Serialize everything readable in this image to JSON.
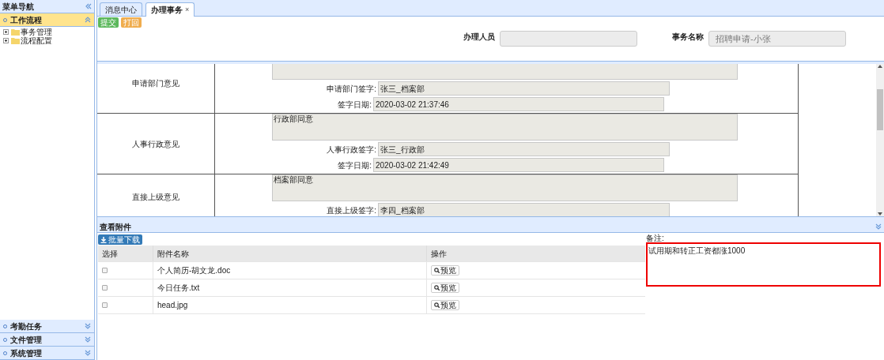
{
  "sidebar": {
    "title": "菜单导航",
    "sections": [
      {
        "title": "工作流程",
        "expanded": true,
        "children": [
          {
            "label": "事务管理"
          },
          {
            "label": "流程配置"
          }
        ]
      },
      {
        "title": "考勤任务",
        "expanded": false
      },
      {
        "title": "文件管理",
        "expanded": false
      },
      {
        "title": "系统管理",
        "expanded": false
      }
    ]
  },
  "tabs": [
    {
      "label": "消息中心",
      "selected": false
    },
    {
      "label": "办理事务",
      "selected": true,
      "close": "×"
    }
  ],
  "toolbar": [
    {
      "label": "提交",
      "kind": "submit"
    },
    {
      "label": "打回",
      "kind": "reject"
    }
  ],
  "header_fields": [
    {
      "label": "办理人员"
    },
    {
      "label": "事务名称",
      "value": "招聘申请-小张"
    }
  ],
  "opinions": [
    {
      "label": "申请部门意见",
      "sign_label": "申请部门签字:",
      "sign": "张三_档案部",
      "date_label": "签字日期:",
      "date": "2020-03-02 21:37:46"
    },
    {
      "label": "人事行政意见",
      "comment": "行政部同意",
      "sign_label": "人事行政签字:",
      "sign": "张三_行政部",
      "date_label": "签字日期:",
      "date": "2020-03-02 21:42:49"
    },
    {
      "label": "直接上级意见",
      "comment": "档案部同意",
      "sign_label": "直接上级签字:",
      "sign": "李四_档案部"
    }
  ],
  "attachments": {
    "title": "查看附件",
    "download_button": "批量下载",
    "columns": [
      "选择",
      "附件名称",
      "操作"
    ],
    "rows": [
      {
        "checked": false,
        "name": "个人简历-胡文龙.doc",
        "action": "预览"
      },
      {
        "checked": false,
        "name": "今日任务.txt",
        "action": "预览"
      },
      {
        "checked": false,
        "name": "head.jpg",
        "action": "预览"
      }
    ]
  },
  "remarks": {
    "label": "备注:",
    "value": "试用期和转正工资都涨1000"
  }
}
